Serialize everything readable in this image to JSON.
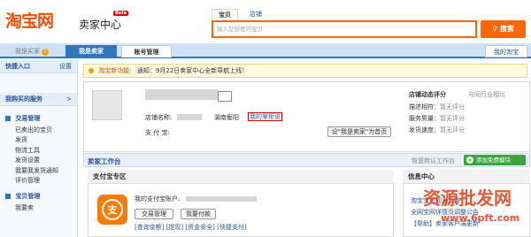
{
  "header": {
    "logo": "淘宝网",
    "seller_center": "卖家中心",
    "beta": "Beta"
  },
  "search": {
    "tab_active": "宝贝",
    "tab_other": "店铺",
    "placeholder": "输入您想要的宝贝",
    "button": "搜索"
  },
  "nav": {
    "tab1": "我是买家",
    "tab2": "我是卖家",
    "tab3": "账号管理",
    "right": "我的淘宝"
  },
  "sidebar": {
    "quick_entry": "快捷入口",
    "settings": "设置",
    "bought_services": "我购买的服务",
    "trade_title": "交易管理",
    "trade_items": [
      "已卖出的宝贝",
      "发货",
      "物流工具",
      "发货设置",
      "我要我发货通知",
      "评价管理"
    ],
    "baby_title": "宝贝管理",
    "baby_items": [
      "我要卖"
    ]
  },
  "notice": {
    "label": "淘宝新功能:",
    "text": "通知：9月22日卖家中心全新导航上线！"
  },
  "store": {
    "name_label": "店铺名称:",
    "location": "湖南衡阳",
    "my_store_link": "我的掌柜说",
    "alipay_label": "支 付 宝:",
    "set_homepage": "设\"我是卖家\"为首页",
    "rating_title": "店铺动态评分",
    "rating_compare": "与同行业相比",
    "ratings": [
      {
        "label": "描述相符：",
        "value": "暂无评分"
      },
      {
        "label": "服务质量：",
        "value": "暂无评分"
      },
      {
        "label": "发货速度：",
        "value": "暂无评分"
      }
    ]
  },
  "workbench": {
    "title": "卖家工作台",
    "restore": "恢复默认工作台",
    "add_module": "添加免费模块"
  },
  "alipay_zone": {
    "title": "支付宝专区",
    "account_label": "我的支付宝账户:",
    "btn_trade": "交易管理",
    "btn_pay": "我要付款",
    "links": [
      "[查询余额]",
      "[提现]",
      "[资金安全]",
      "[快捷支付]"
    ],
    "icon_glyph": "支"
  },
  "info_center": {
    "title": "信息中心",
    "items": [
      "淘宝宝贝规则公告",
      "全网宝网详情页调整公告",
      "【帮助】卖家客户端更新"
    ]
  },
  "watermark": {
    "line1": "资源批发网",
    "line2": "www.6pft.com"
  }
}
